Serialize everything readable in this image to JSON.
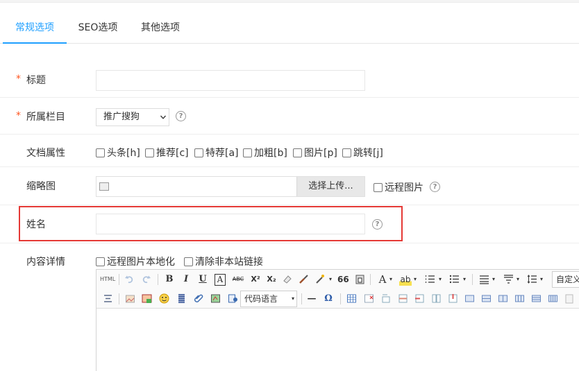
{
  "tabs": [
    {
      "label": "常规选项",
      "active": true
    },
    {
      "label": "SEO选项",
      "active": false
    },
    {
      "label": "其他选项",
      "active": false
    }
  ],
  "form": {
    "required_mark": "*",
    "title": {
      "label": "标题",
      "value": "",
      "placeholder": ""
    },
    "category": {
      "label": "所属栏目",
      "selected": "推广搜狗"
    },
    "attributes": {
      "label": "文档属性",
      "options": [
        "头条[h]",
        "推荐[c]",
        "特荐[a]",
        "加粗[b]",
        "图片[p]",
        "跳转[j]"
      ]
    },
    "thumbnail": {
      "label": "缩略图",
      "upload_label": "选择上传...",
      "remote_label": "远程图片"
    },
    "name": {
      "label": "姓名",
      "value": ""
    },
    "content": {
      "label": "内容详情",
      "localize_label": "远程图片本地化",
      "strip_links_label": "清除非本站链接"
    }
  },
  "editor": {
    "html_label": "HTML",
    "code_lang_label": "代码语言",
    "custom_title_label": "自定义标题",
    "bold": "B",
    "italic": "I",
    "underline": "U",
    "border_char": "A",
    "strike": "ABC",
    "superscript": "X²",
    "subscript": "X₂",
    "quote": "66",
    "font_color": "A",
    "bg_color": "ab",
    "hr": "—",
    "omega": "Ω"
  },
  "help_glyph": "?",
  "colors": {
    "accent": "#1e9fff",
    "required": "#ff5722",
    "highlight_box": "#e53935"
  }
}
